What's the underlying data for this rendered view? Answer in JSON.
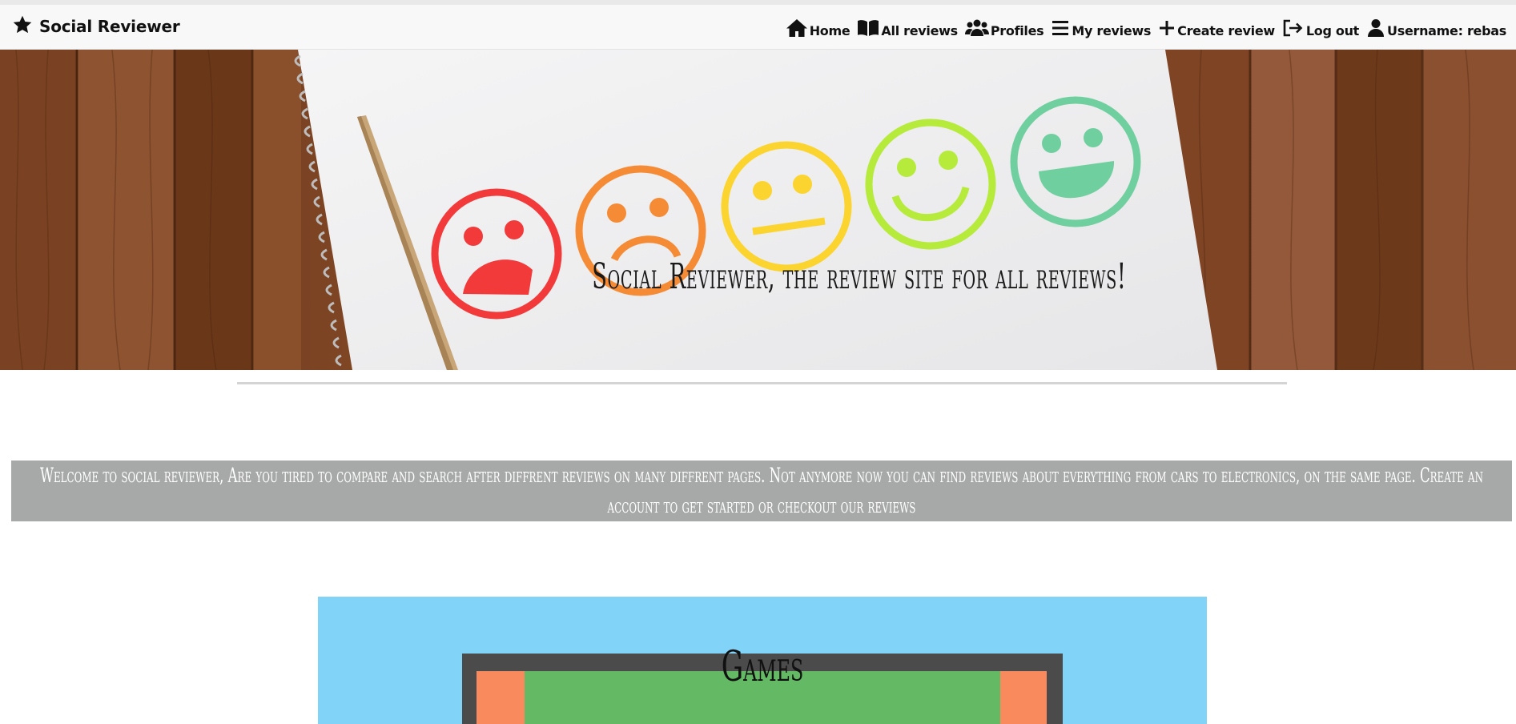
{
  "brand": {
    "name": "Social Reviewer",
    "icon": "star-icon"
  },
  "nav": {
    "home": "Home",
    "all_reviews": "All reviews",
    "profiles": "Profiles",
    "my_reviews": "My reviews",
    "create_review": "Create review",
    "log_out": "Log out",
    "username": "Username: rebas"
  },
  "hero": {
    "title": "Social Reviewer, the review site for all reviews!",
    "faces": [
      "very-sad-face",
      "sad-face",
      "neutral-face",
      "happy-face",
      "very-happy-face"
    ]
  },
  "welcome": {
    "text": "Welcome to social reviewer, Are you tired to compare and search after diffrent reviews on many diffrent pages. Not anymore now you can find reviews about everything from cars to electronics, on the same page. Create an account to get started or checkout our reviews"
  },
  "categories": [
    {
      "title": "Games"
    }
  ],
  "colors": {
    "navbar_bg": "#f8f8f9",
    "welcome_bg": "#a7a9a8",
    "games_bg": "#82d3f8",
    "face_red": "#f23a3b",
    "face_orange": "#f58b34",
    "face_yellow": "#fbd42f",
    "face_lime": "#b6ea3b",
    "face_green": "#6fcf9e"
  }
}
